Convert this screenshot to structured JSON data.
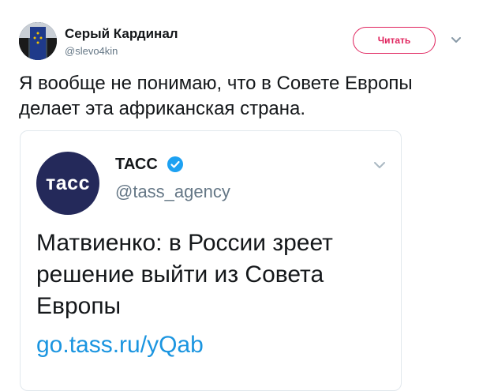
{
  "tweet": {
    "author": {
      "name": "Серый Кардинал",
      "handle": "@slevo4kin"
    },
    "follow_label": "Читать",
    "text": "Я вообще не понимаю, что в Совете Европы делает эта африканская страна."
  },
  "quoted": {
    "avatar_text": "тасс",
    "name": "ТАСС",
    "verified": true,
    "handle": "@tass_agency",
    "text": "Матвиенко: в России зреет решение выйти из Совета Европы",
    "link": "go.tass.ru/yQab"
  },
  "colors": {
    "follow_accent": "#e0245e",
    "link": "#1b95e0",
    "verified": "#1da1f2",
    "tass_brand": "#24295a"
  },
  "icons": {
    "tweet_menu": "chevron-down-icon",
    "quoted_menu": "chevron-down-icon",
    "verified": "verified-badge-icon"
  }
}
